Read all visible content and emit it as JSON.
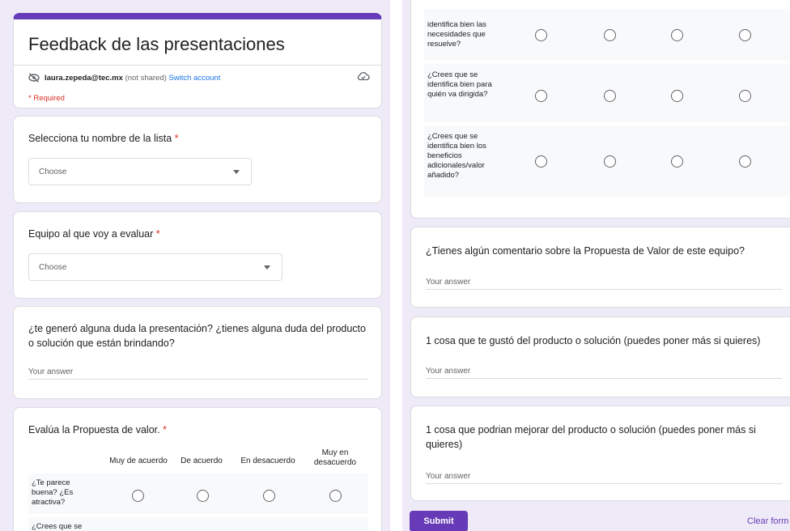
{
  "header": {
    "title": "Feedback de las presentaciones",
    "account_email": "laura.zepeda@tec.mx",
    "account_status": "(not shared)",
    "switch_account": "Switch account",
    "required_note": "* Required"
  },
  "questions": {
    "name": {
      "title": "Selecciona tu nombre de la lista",
      "required_mark": "*",
      "placeholder": "Choose"
    },
    "team": {
      "title": "Equipo al que voy a evaluar",
      "required_mark": "*",
      "placeholder": "Choose"
    },
    "doubts": {
      "title": "¿te generó alguna duda la presentación? ¿tienes alguna duda del producto o solución que están brindando?",
      "answer_placeholder": "Your answer"
    },
    "value_prop": {
      "title": "Evalúa la Propuesta de valor.",
      "required_mark": "*",
      "columns": [
        "Muy de acuerdo",
        "De acuerdo",
        "En desacuerdo",
        "Muy en desacuerdo"
      ],
      "rows": [
        "¿Te parece buena? ¿Es atractiva?",
        "¿Crees que se",
        "identifica bien las necesidades que resuelve?",
        "¿Crees que se identifica bien para quién va dirigida?",
        "¿Crees que se identifica bien los beneficios adicionales/valor añadido?"
      ]
    },
    "comment": {
      "title": "¿Tienes algún comentario sobre la Propuesta de Valor de este equipo?",
      "answer_placeholder": "Your answer"
    },
    "liked": {
      "title": "1 cosa que te gustó del producto o solución (puedes poner más si quieres)",
      "answer_placeholder": "Your answer"
    },
    "improve": {
      "title": "1 cosa que podrian mejorar del producto o solución (puedes poner más si quieres)",
      "answer_placeholder": "Your answer"
    }
  },
  "footer": {
    "submit_label": "Submit",
    "clear_label": "Clear form"
  },
  "icons": {
    "hidden_eye": "eye-off-icon",
    "cloud": "cloud-check-icon",
    "caret": "dropdown-caret-icon",
    "radio": "radio-button-icon"
  },
  "colors": {
    "accent": "#673ab7",
    "background": "#efeaf7",
    "required": "#d93025",
    "link": "#1a73e8"
  }
}
